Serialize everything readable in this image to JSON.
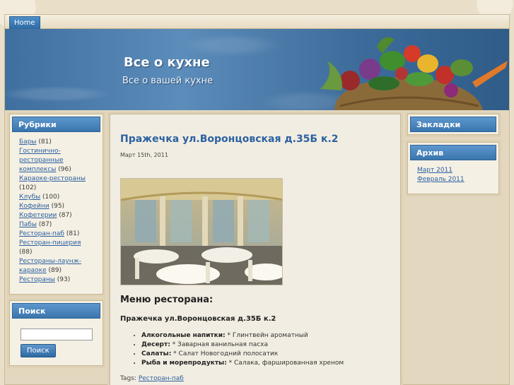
{
  "nav": {
    "home_label": "Home"
  },
  "header": {
    "title": "Все о кухне",
    "description": "Все о вашей кухне"
  },
  "sidebar_left": {
    "categories_title": "Рубрики",
    "categories": [
      {
        "label": "Бары",
        "count": "(81)"
      },
      {
        "label": "Гостинично-ресторанные комплексы",
        "count": "(96)"
      },
      {
        "label": "Караоке-рестораны",
        "count": "(102)"
      },
      {
        "label": "Клубы",
        "count": "(100)"
      },
      {
        "label": "Кофейни",
        "count": "(95)"
      },
      {
        "label": "Кофетерии",
        "count": "(87)"
      },
      {
        "label": "Пабы",
        "count": "(87)"
      },
      {
        "label": "Ресторан-паб",
        "count": "(81)"
      },
      {
        "label": "Ресторан-пицерия",
        "count": "(88)"
      },
      {
        "label": "Рестораны-лаунж-караоке",
        "count": "(89)"
      },
      {
        "label": "Рестораны",
        "count": "(93)"
      }
    ],
    "search_title": "Поиск",
    "search_value": "",
    "search_button": "Поиск"
  },
  "sidebar_right": {
    "bookmarks_title": "Закладки",
    "archive_title": "Архив",
    "archive": [
      "Март 2011",
      "Февраль 2011"
    ]
  },
  "post": {
    "title": "Пражечка ул.Воронцовская д.35Б к.2",
    "date": "Март 15th, 2011",
    "menu_heading": "Меню ресторана:",
    "subheading": "Пражечка ул.Воронцовская д.35Б к.2",
    "items": [
      {
        "label": "Алкогольные напитки:",
        "text": " * Глинтвейн ароматный"
      },
      {
        "label": "Десерт:",
        "text": " * Заварная ванильная пасха"
      },
      {
        "label": "Салаты:",
        "text": " * Салат Новогодний полосатик"
      },
      {
        "label": "Рыба и морепродукты:",
        "text": " * Салака, фаршированная хреном"
      }
    ],
    "tags_prefix": "Tags: ",
    "tag": "Ресторан-паб"
  },
  "colors": {
    "accent": "#2b61a1",
    "widget_header": "#4a85bd",
    "background": "#e3d8bf"
  },
  "icons": {
    "header_image": "vegetables-basket"
  }
}
